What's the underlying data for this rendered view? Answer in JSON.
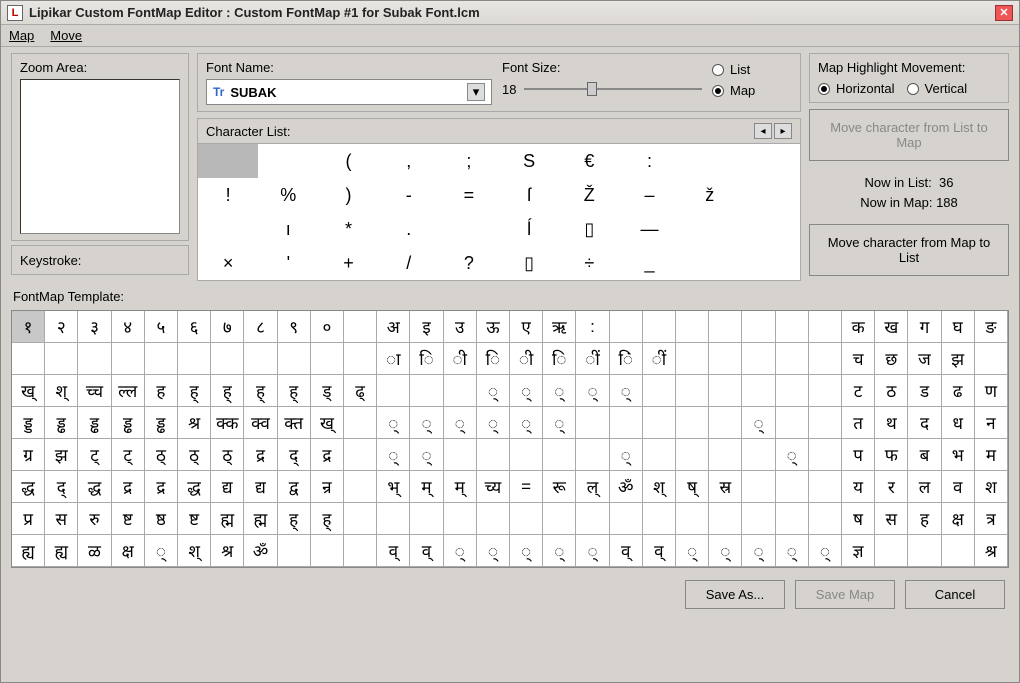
{
  "title": "Lipikar Custom FontMap Editor :  Custom FontMap #1 for Subak Font.lcm",
  "menu": {
    "map": "Map",
    "move": "Move"
  },
  "zoom": {
    "label": "Zoom Area:"
  },
  "keystroke": {
    "label": "Keystroke:"
  },
  "font": {
    "label": "Font Name:",
    "value": "SUBAK",
    "size_label": "Font Size:",
    "size_value": "18"
  },
  "view": {
    "list_label": "List",
    "map_label": "Map",
    "selected": "map"
  },
  "highlight": {
    "label": "Map Highlight Movement:",
    "horizontal_label": "Horizontal",
    "vertical_label": "Vertical",
    "selected": "horizontal"
  },
  "charlist": {
    "label": "Character List:",
    "cells": [
      "",
      "",
      "(",
      ",",
      ";",
      "S",
      "€",
      ":",
      "",
      "",
      "!",
      "%",
      ")",
      "-",
      "=",
      "ſ",
      "Ž",
      "–",
      "ž",
      "",
      "",
      "ı",
      "*",
      ".",
      "",
      "ĺ",
      "▯",
      "—",
      "",
      "",
      "×",
      "'",
      "+",
      "/",
      "?",
      "▯",
      "÷",
      "_",
      "",
      ""
    ]
  },
  "move_panel": {
    "to_map": "Move character from List to Map",
    "to_list": "Move character from Map to List",
    "list_count_label": "Now in List:",
    "list_count": "36",
    "map_count_label": "Now in Map:",
    "map_count": "188"
  },
  "template": {
    "label": "FontMap Template:",
    "cells": [
      "१",
      "२",
      "३",
      "४",
      "५",
      "६",
      "७",
      "८",
      "९",
      "०",
      "",
      "अ",
      "इ",
      "उ",
      "ऊ",
      "ए",
      "ऋ",
      ":",
      "",
      "",
      "",
      "",
      "",
      "",
      "",
      "क",
      "ख",
      "ग",
      "घ",
      "ङ",
      "",
      "",
      "",
      "",
      "",
      "",
      "",
      "",
      "",
      "",
      "",
      "ा",
      "ि",
      "ी",
      "ि",
      "ी",
      "ि",
      "ीं",
      "िं",
      "ीं",
      "",
      "",
      "",
      "",
      "",
      "च",
      "छ",
      "ज",
      "झ",
      "",
      "ख्",
      "श्",
      "च्च",
      "ल्ल",
      "ह",
      "ह्",
      "ह्",
      "ह्",
      "ह्",
      "ड्",
      "ढ्",
      "",
      "",
      "",
      "्",
      "्",
      "्",
      "्",
      "्",
      "",
      "",
      "",
      "",
      "",
      "",
      "ट",
      "ठ",
      "ड",
      "ढ",
      "ण",
      "ड्ड",
      "ड्ढ",
      "ड्ढ",
      "ड्ढ",
      "ड्ढ",
      "श्र",
      "क्क",
      "क्व",
      "क्त",
      "ख्",
      "",
      "्",
      "्",
      "्",
      "्",
      "्",
      "्",
      "",
      "",
      "",
      "",
      "",
      "्",
      "",
      "",
      "त",
      "थ",
      "द",
      "ध",
      "न",
      "ग्र",
      "झ",
      "ट्",
      "ट्",
      "ठ्",
      "ठ्",
      "ठ्",
      "द्र",
      "द्",
      "द्र",
      "",
      "्",
      "्",
      "",
      "",
      "",
      "",
      "",
      "्",
      "",
      "",
      "",
      "",
      "्",
      "",
      "प",
      "फ",
      "ब",
      "भ",
      "म",
      "द्ध",
      "द्",
      "द्ध",
      "द्र",
      "द्र",
      "द्ध",
      "द्य",
      "द्य",
      "द्व",
      "न्र",
      "",
      "भ्",
      "म्",
      "म्",
      "च्य",
      "=",
      "रू",
      "ल्",
      "ॐ",
      "श्",
      "ष्",
      "स्र",
      "",
      "",
      "",
      "य",
      "र",
      "ल",
      "व",
      "श",
      "प्र",
      "स",
      "रु",
      "ष्ट",
      "ष्ठ",
      "ष्ट",
      "ह्म",
      "ह्म",
      "ह्",
      "ह्",
      "",
      "",
      "",
      "",
      "",
      "",
      "",
      "",
      "",
      "",
      "",
      "",
      "",
      "",
      "",
      "ष",
      "स",
      "ह",
      "क्ष",
      "त्र",
      "ह्य",
      "ह्य",
      "ळ",
      "क्ष",
      "्",
      "श्",
      "श्र",
      "ॐ",
      "",
      "",
      "",
      "व्",
      "व्",
      "्",
      "्",
      "्",
      "्",
      "्",
      "व्",
      "व्",
      "्",
      "्",
      "्",
      "्",
      "्",
      "ज्ञ",
      "",
      "",
      "",
      "श्र"
    ]
  },
  "buttons": {
    "save_as": "Save As...",
    "save_map": "Save Map",
    "cancel": "Cancel"
  }
}
